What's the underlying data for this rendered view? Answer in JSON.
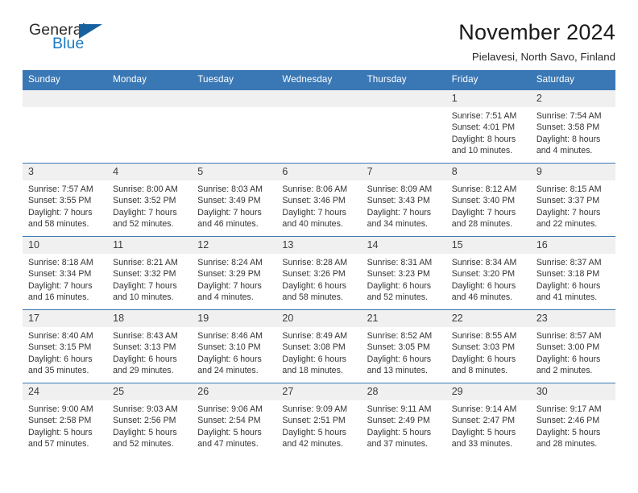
{
  "brand": {
    "name_top": "General",
    "name_bottom": "Blue",
    "triangle_color": "#16619e",
    "blue_color": "#1b7ac4"
  },
  "header": {
    "title": "November 2024",
    "subtitle": "Pielavesi, North Savo, Finland"
  },
  "theme": {
    "header_blue": "#3a78b5",
    "daynum_band": "#f0f0f0",
    "text": "#333333"
  },
  "labels": {
    "sunrise_prefix": "Sunrise:",
    "sunset_prefix": "Sunset:",
    "daylight_prefix": "Daylight:"
  },
  "weekday_headers": [
    "Sunday",
    "Monday",
    "Tuesday",
    "Wednesday",
    "Thursday",
    "Friday",
    "Saturday"
  ],
  "weeks": [
    [
      {
        "day": "",
        "lines": []
      },
      {
        "day": "",
        "lines": []
      },
      {
        "day": "",
        "lines": []
      },
      {
        "day": "",
        "lines": []
      },
      {
        "day": "",
        "lines": []
      },
      {
        "day": "1",
        "lines": [
          "Sunrise: 7:51 AM",
          "Sunset: 4:01 PM",
          "Daylight: 8 hours",
          "and 10 minutes."
        ]
      },
      {
        "day": "2",
        "lines": [
          "Sunrise: 7:54 AM",
          "Sunset: 3:58 PM",
          "Daylight: 8 hours",
          "and 4 minutes."
        ]
      }
    ],
    [
      {
        "day": "3",
        "lines": [
          "Sunrise: 7:57 AM",
          "Sunset: 3:55 PM",
          "Daylight: 7 hours",
          "and 58 minutes."
        ]
      },
      {
        "day": "4",
        "lines": [
          "Sunrise: 8:00 AM",
          "Sunset: 3:52 PM",
          "Daylight: 7 hours",
          "and 52 minutes."
        ]
      },
      {
        "day": "5",
        "lines": [
          "Sunrise: 8:03 AM",
          "Sunset: 3:49 PM",
          "Daylight: 7 hours",
          "and 46 minutes."
        ]
      },
      {
        "day": "6",
        "lines": [
          "Sunrise: 8:06 AM",
          "Sunset: 3:46 PM",
          "Daylight: 7 hours",
          "and 40 minutes."
        ]
      },
      {
        "day": "7",
        "lines": [
          "Sunrise: 8:09 AM",
          "Sunset: 3:43 PM",
          "Daylight: 7 hours",
          "and 34 minutes."
        ]
      },
      {
        "day": "8",
        "lines": [
          "Sunrise: 8:12 AM",
          "Sunset: 3:40 PM",
          "Daylight: 7 hours",
          "and 28 minutes."
        ]
      },
      {
        "day": "9",
        "lines": [
          "Sunrise: 8:15 AM",
          "Sunset: 3:37 PM",
          "Daylight: 7 hours",
          "and 22 minutes."
        ]
      }
    ],
    [
      {
        "day": "10",
        "lines": [
          "Sunrise: 8:18 AM",
          "Sunset: 3:34 PM",
          "Daylight: 7 hours",
          "and 16 minutes."
        ]
      },
      {
        "day": "11",
        "lines": [
          "Sunrise: 8:21 AM",
          "Sunset: 3:32 PM",
          "Daylight: 7 hours",
          "and 10 minutes."
        ]
      },
      {
        "day": "12",
        "lines": [
          "Sunrise: 8:24 AM",
          "Sunset: 3:29 PM",
          "Daylight: 7 hours",
          "and 4 minutes."
        ]
      },
      {
        "day": "13",
        "lines": [
          "Sunrise: 8:28 AM",
          "Sunset: 3:26 PM",
          "Daylight: 6 hours",
          "and 58 minutes."
        ]
      },
      {
        "day": "14",
        "lines": [
          "Sunrise: 8:31 AM",
          "Sunset: 3:23 PM",
          "Daylight: 6 hours",
          "and 52 minutes."
        ]
      },
      {
        "day": "15",
        "lines": [
          "Sunrise: 8:34 AM",
          "Sunset: 3:20 PM",
          "Daylight: 6 hours",
          "and 46 minutes."
        ]
      },
      {
        "day": "16",
        "lines": [
          "Sunrise: 8:37 AM",
          "Sunset: 3:18 PM",
          "Daylight: 6 hours",
          "and 41 minutes."
        ]
      }
    ],
    [
      {
        "day": "17",
        "lines": [
          "Sunrise: 8:40 AM",
          "Sunset: 3:15 PM",
          "Daylight: 6 hours",
          "and 35 minutes."
        ]
      },
      {
        "day": "18",
        "lines": [
          "Sunrise: 8:43 AM",
          "Sunset: 3:13 PM",
          "Daylight: 6 hours",
          "and 29 minutes."
        ]
      },
      {
        "day": "19",
        "lines": [
          "Sunrise: 8:46 AM",
          "Sunset: 3:10 PM",
          "Daylight: 6 hours",
          "and 24 minutes."
        ]
      },
      {
        "day": "20",
        "lines": [
          "Sunrise: 8:49 AM",
          "Sunset: 3:08 PM",
          "Daylight: 6 hours",
          "and 18 minutes."
        ]
      },
      {
        "day": "21",
        "lines": [
          "Sunrise: 8:52 AM",
          "Sunset: 3:05 PM",
          "Daylight: 6 hours",
          "and 13 minutes."
        ]
      },
      {
        "day": "22",
        "lines": [
          "Sunrise: 8:55 AM",
          "Sunset: 3:03 PM",
          "Daylight: 6 hours",
          "and 8 minutes."
        ]
      },
      {
        "day": "23",
        "lines": [
          "Sunrise: 8:57 AM",
          "Sunset: 3:00 PM",
          "Daylight: 6 hours",
          "and 2 minutes."
        ]
      }
    ],
    [
      {
        "day": "24",
        "lines": [
          "Sunrise: 9:00 AM",
          "Sunset: 2:58 PM",
          "Daylight: 5 hours",
          "and 57 minutes."
        ]
      },
      {
        "day": "25",
        "lines": [
          "Sunrise: 9:03 AM",
          "Sunset: 2:56 PM",
          "Daylight: 5 hours",
          "and 52 minutes."
        ]
      },
      {
        "day": "26",
        "lines": [
          "Sunrise: 9:06 AM",
          "Sunset: 2:54 PM",
          "Daylight: 5 hours",
          "and 47 minutes."
        ]
      },
      {
        "day": "27",
        "lines": [
          "Sunrise: 9:09 AM",
          "Sunset: 2:51 PM",
          "Daylight: 5 hours",
          "and 42 minutes."
        ]
      },
      {
        "day": "28",
        "lines": [
          "Sunrise: 9:11 AM",
          "Sunset: 2:49 PM",
          "Daylight: 5 hours",
          "and 37 minutes."
        ]
      },
      {
        "day": "29",
        "lines": [
          "Sunrise: 9:14 AM",
          "Sunset: 2:47 PM",
          "Daylight: 5 hours",
          "and 33 minutes."
        ]
      },
      {
        "day": "30",
        "lines": [
          "Sunrise: 9:17 AM",
          "Sunset: 2:46 PM",
          "Daylight: 5 hours",
          "and 28 minutes."
        ]
      }
    ]
  ]
}
